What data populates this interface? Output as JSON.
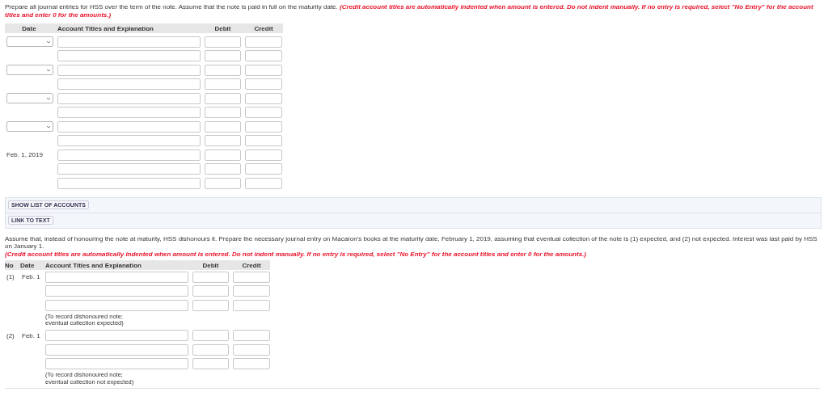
{
  "part1": {
    "intro": "Prepare all journal entries for HSS over the term of the note. Assume that the note is paid in full on the maturity date.",
    "note": "(Credit account titles are automatically indented when amount is entered. Do not indent manually. If no entry is required, select \"No Entry\" for the account titles and enter 0 for the amounts.)",
    "columns": [
      "Date",
      "Account Titles and Explanation",
      "Debit",
      "Credit"
    ],
    "entries": [
      {
        "kind": "dropdown",
        "lines": [
          {
            "kind": "input-row"
          },
          {
            "kind": "input-row"
          }
        ]
      },
      {
        "kind": "dropdown",
        "lines": [
          {
            "kind": "input-row"
          },
          {
            "kind": "input-row"
          }
        ]
      },
      {
        "kind": "dropdown",
        "lines": [
          {
            "kind": "input-row"
          },
          {
            "kind": "input-row"
          }
        ]
      },
      {
        "kind": "dropdown",
        "lines": [
          {
            "kind": "input-row"
          },
          {
            "kind": "input-row"
          }
        ]
      },
      {
        "kind": "text",
        "date": "Feb. 1, 2019",
        "lines": [
          {
            "kind": "input-row"
          },
          {
            "kind": "input-row"
          },
          {
            "kind": "input-row"
          }
        ]
      }
    ]
  },
  "buttons": [
    "SHOW LIST OF ACCOUNTS",
    "LINK TO TEXT"
  ],
  "part2": {
    "intro": "Assume that, instead of honouring the note at maturity, HSS dishonours it. Prepare the necessary journal entry on Macaron's books at the maturity date, February 1, 2019, assuming that eventual collection of the note is (1) expected, and (2) not expected. Interest was last paid by HSS on January 1.",
    "note": "(Credit account titles are automatically indented when amount is entered. Do not indent manually. If no entry is required, select \"No Entry\" for the account titles and enter 0 for the amounts.)",
    "columns": [
      "No",
      "Date",
      "Account Titles and Explanation",
      "Debit",
      "Credit"
    ],
    "entries": [
      {
        "no": "(1)",
        "date": "Feb. 1",
        "lines": [
          {
            "kind": "input-row"
          },
          {
            "kind": "input-row"
          },
          {
            "kind": "input-row"
          }
        ],
        "explanation": "(To record dishonoured note;\neventual collection expected)"
      },
      {
        "no": "(2)",
        "date": "Feb. 1",
        "lines": [
          {
            "kind": "input-row"
          },
          {
            "kind": "input-row"
          },
          {
            "kind": "input-row"
          }
        ],
        "explanation": "(To record dishonoured note;\neventual collection not expected)"
      }
    ]
  }
}
